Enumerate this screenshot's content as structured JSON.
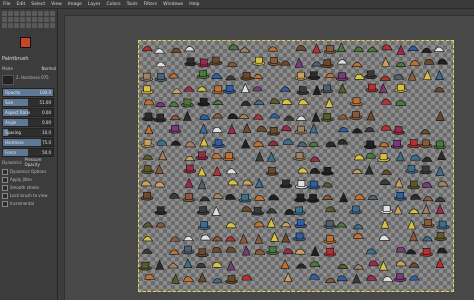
{
  "menu": [
    "File",
    "Edit",
    "Select",
    "View",
    "Image",
    "Layer",
    "Colors",
    "Tools",
    "Filters",
    "Windows",
    "Help"
  ],
  "colors": {
    "foreground": "#c9442b",
    "background": "#f2f2f2"
  },
  "tool_options": {
    "title": "Paintbrush",
    "mode_label": "Mode",
    "mode_value": "Normal",
    "brush_name": "2. Hardness 075",
    "sliders": [
      {
        "label": "Opacity",
        "value": "100.0",
        "fraction": 1.0
      },
      {
        "label": "Size",
        "value": "51.00",
        "fraction": 0.5
      },
      {
        "label": "Aspect Ratio",
        "value": "0.00",
        "fraction": 0.5
      },
      {
        "label": "Angle",
        "value": "0.00",
        "fraction": 0.5
      },
      {
        "label": "Spacing",
        "value": "10.0",
        "fraction": 0.1
      },
      {
        "label": "Hardness",
        "value": "75.0",
        "fraction": 0.75
      },
      {
        "label": "Force",
        "value": "50.0",
        "fraction": 0.5
      }
    ],
    "dynamics_label": "Dynamics",
    "dynamics_value": "Pressure Opacity",
    "checks": [
      "Dynamics Options",
      "Apply Jitter",
      "Smooth stroke",
      "Lock brush to view",
      "Incremental"
    ]
  },
  "hat_colors": [
    "#2b2b2b",
    "#6b4a2b",
    "#8a5a3a",
    "#3a3a3a",
    "#b53030",
    "#2f5fa0",
    "#d8c040",
    "#4a7a3a",
    "#7a3a7a",
    "#c07030",
    "#e0e0e0",
    "#506070",
    "#a08060",
    "#202020",
    "#3e6e8e",
    "#9a2a4a",
    "#caa060",
    "#5a5a2a"
  ]
}
